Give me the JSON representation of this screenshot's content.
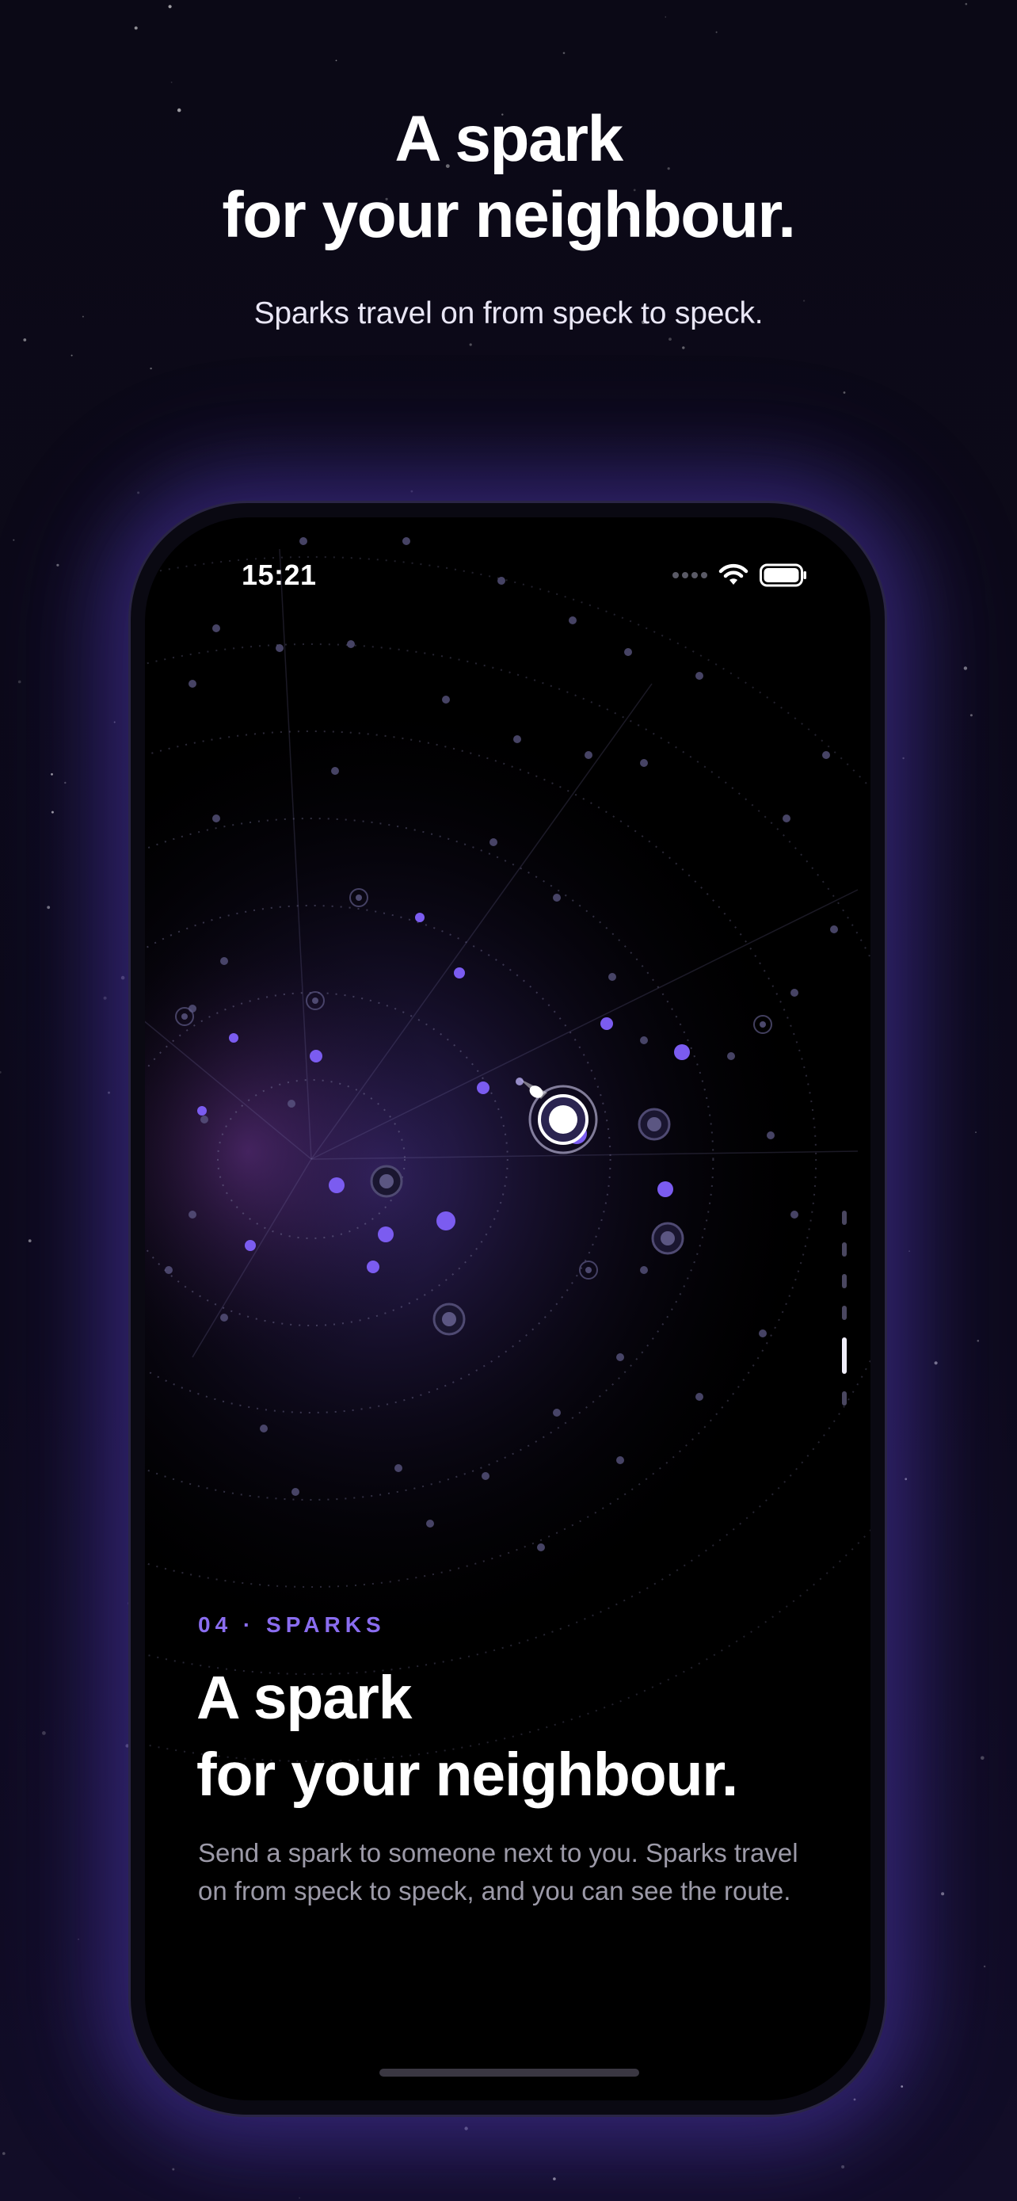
{
  "hero": {
    "title_line1": "A spark",
    "title_line2": "for your neighbour.",
    "subtitle": "Sparks travel on from speck to speck."
  },
  "status_bar": {
    "time": "15:21",
    "icons": [
      "signal-icon",
      "wifi-icon",
      "battery-icon"
    ]
  },
  "section": {
    "kicker": "04 · SPARKS",
    "title_line1": "A spark",
    "title_line2": "for your neighbour.",
    "body": "Send a spark to someone next to you. Sparks travel on from speck to speck, and you can see the route."
  },
  "page_indicator": {
    "count": 6,
    "active_index": 4
  },
  "colors": {
    "background": "#0b0916",
    "accent": "#8a6df0",
    "node_purple": "#7b5cf0",
    "body_text": "#9c9aa8"
  }
}
